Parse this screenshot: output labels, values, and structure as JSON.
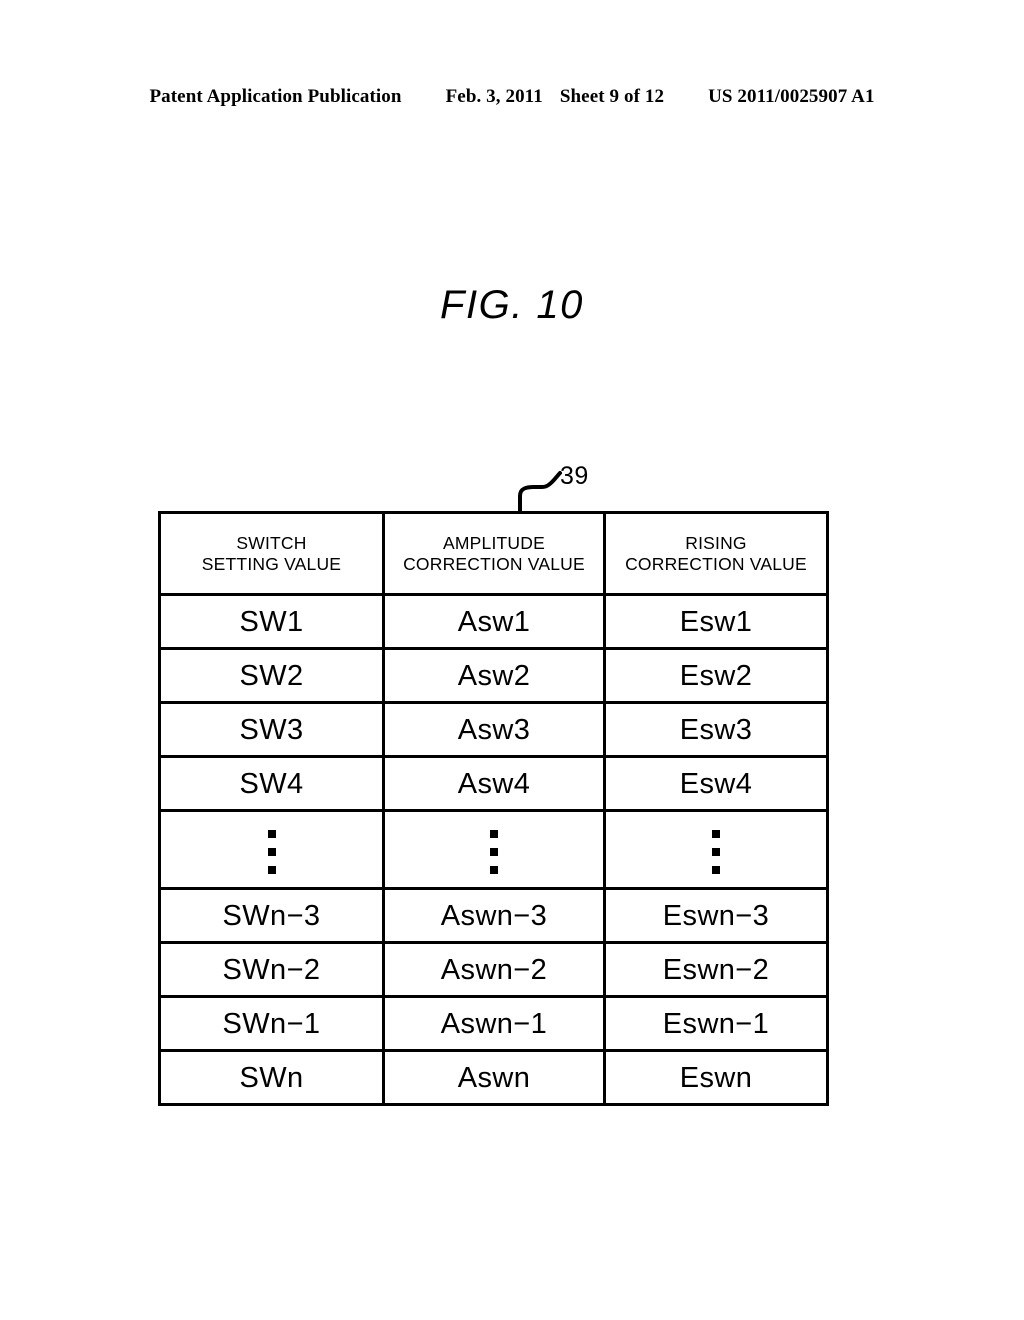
{
  "page_header": {
    "publication": "Patent Application Publication",
    "date": "Feb. 3, 2011",
    "sheet": "Sheet 9 of 12",
    "patent_number": "US 2011/0025907 A1"
  },
  "figure": {
    "title": "FIG. 10",
    "reference_numeral": "39",
    "leader_icon": "curved-leader-line"
  },
  "table": {
    "columns": [
      {
        "line1": "SWITCH",
        "line2": "SETTING VALUE"
      },
      {
        "line1": "AMPLITUDE",
        "line2": "CORRECTION VALUE"
      },
      {
        "line1": "RISING",
        "line2": "CORRECTION VALUE"
      }
    ],
    "rows": [
      {
        "type": "data",
        "switch": "SW1",
        "amplitude": "Asw1",
        "rising": "Esw1"
      },
      {
        "type": "data",
        "switch": "SW2",
        "amplitude": "Asw2",
        "rising": "Esw2"
      },
      {
        "type": "data",
        "switch": "SW3",
        "amplitude": "Asw3",
        "rising": "Esw3"
      },
      {
        "type": "data",
        "switch": "SW4",
        "amplitude": "Asw4",
        "rising": "Esw4"
      },
      {
        "type": "ellipsis",
        "switch": "",
        "amplitude": "",
        "rising": ""
      },
      {
        "type": "data",
        "switch": "SWn−3",
        "amplitude": "Aswn−3",
        "rising": "Eswn−3"
      },
      {
        "type": "data",
        "switch": "SWn−2",
        "amplitude": "Aswn−2",
        "rising": "Eswn−2"
      },
      {
        "type": "data",
        "switch": "SWn−1",
        "amplitude": "Aswn−1",
        "rising": "Eswn−1"
      },
      {
        "type": "data",
        "switch": "SWn",
        "amplitude": "Aswn",
        "rising": "Eswn"
      }
    ]
  },
  "colors": {
    "ink": "#000000",
    "paper": "#ffffff"
  }
}
